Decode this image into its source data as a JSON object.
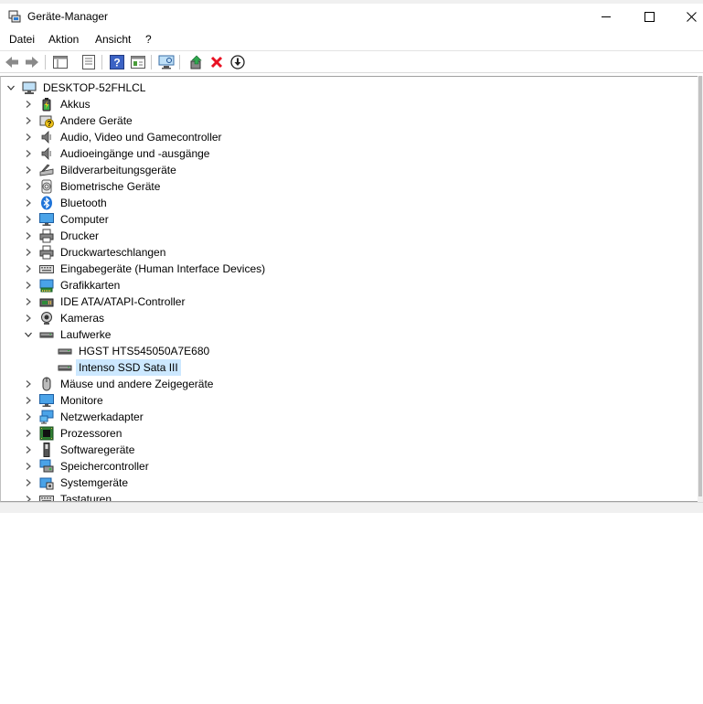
{
  "window": {
    "title": "Geräte-Manager",
    "minimize_glyph": "—",
    "maximize_glyph": "☐",
    "close_glyph": "✕"
  },
  "menu": [
    "Datei",
    "Aktion",
    "Ansicht",
    "?"
  ],
  "toolbar": [
    "back-icon",
    "forward-icon",
    "show-hide-tree-icon",
    "properties-icon",
    "help-icon",
    "action-view-icon",
    "scan-hardware-icon",
    "update-driver-icon",
    "uninstall-device-icon",
    "disable-device-icon"
  ],
  "tree": {
    "root": "DESKTOP-52FHLCL",
    "categories": [
      {
        "label": "Akkus",
        "icon": "battery-icon",
        "expanded": false
      },
      {
        "label": "Andere Geräte",
        "icon": "unknown-device-icon",
        "expanded": false
      },
      {
        "label": "Audio, Video und Gamecontroller",
        "icon": "speaker-icon",
        "expanded": false
      },
      {
        "label": "Audioeingänge und -ausgänge",
        "icon": "speaker-icon",
        "expanded": false
      },
      {
        "label": "Bildverarbeitungsgeräte",
        "icon": "scanner-icon",
        "expanded": false
      },
      {
        "label": "Biometrische Geräte",
        "icon": "fingerprint-icon",
        "expanded": false
      },
      {
        "label": "Bluetooth",
        "icon": "bluetooth-icon",
        "expanded": false
      },
      {
        "label": "Computer",
        "icon": "monitor-icon",
        "expanded": false
      },
      {
        "label": "Drucker",
        "icon": "printer-icon",
        "expanded": false
      },
      {
        "label": "Druckwarteschlangen",
        "icon": "printer-icon",
        "expanded": false
      },
      {
        "label": "Eingabegeräte (Human Interface Devices)",
        "icon": "keyboard-icon",
        "expanded": false
      },
      {
        "label": "Grafikkarten",
        "icon": "display-adapter-icon",
        "expanded": false
      },
      {
        "label": "IDE ATA/ATAPI-Controller",
        "icon": "controller-icon",
        "expanded": false
      },
      {
        "label": "Kameras",
        "icon": "webcam-icon",
        "expanded": false
      },
      {
        "label": "Laufwerke",
        "icon": "drive-icon",
        "expanded": true,
        "children": [
          {
            "label": "HGST HTS545050A7E680",
            "icon": "drive-icon"
          },
          {
            "label": "Intenso SSD Sata III",
            "icon": "drive-icon",
            "selected": true
          }
        ]
      },
      {
        "label": "Mäuse und andere Zeigegeräte",
        "icon": "mouse-icon",
        "expanded": false
      },
      {
        "label": "Monitore",
        "icon": "monitor-icon",
        "expanded": false
      },
      {
        "label": "Netzwerkadapter",
        "icon": "network-icon",
        "expanded": false
      },
      {
        "label": "Prozessoren",
        "icon": "cpu-icon",
        "expanded": false
      },
      {
        "label": "Softwaregeräte",
        "icon": "software-device-icon",
        "expanded": false
      },
      {
        "label": "Speichercontroller",
        "icon": "storage-controller-icon",
        "expanded": false
      },
      {
        "label": "Systemgeräte",
        "icon": "system-device-icon",
        "expanded": false
      },
      {
        "label": "Tastaturen",
        "icon": "keyboard-icon",
        "expanded": false
      }
    ]
  },
  "colors": {
    "selection": "#cce8ff",
    "uninstall_red": "#e81123"
  }
}
